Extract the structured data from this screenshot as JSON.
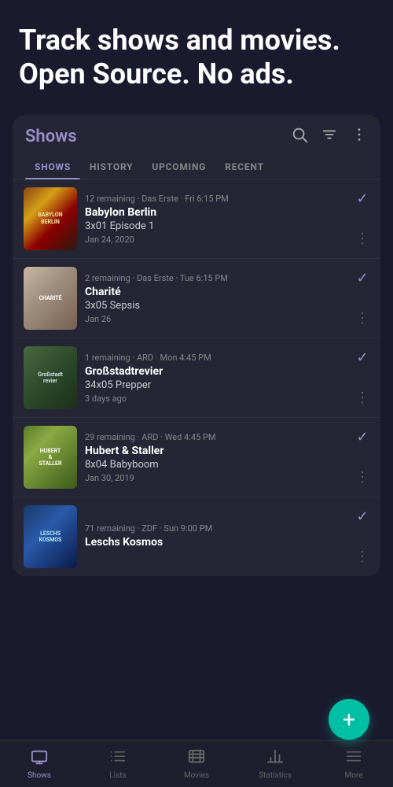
{
  "hero": {
    "title": "Track shows and movies. Open Source. No ads."
  },
  "card": {
    "title": "Shows",
    "tabs": [
      {
        "label": "SHOWS",
        "active": true
      },
      {
        "label": "HISTORY",
        "active": false
      },
      {
        "label": "UPCOMING",
        "active": false
      },
      {
        "label": "RECENT",
        "active": false
      }
    ]
  },
  "shows": [
    {
      "id": 1,
      "poster_label": "BABYLON\nBERLIN",
      "poster_class": "poster-babylon",
      "meta": "12 remaining · Das Erste · Fri 6:15 PM",
      "title": "Babylon Berlin",
      "episode": "3x01 Episode 1",
      "date": "Jan 24, 2020"
    },
    {
      "id": 2,
      "poster_label": "CHARITÉ",
      "poster_class": "poster-charite",
      "meta": "2 remaining · Das Erste · Tue 6:15 PM",
      "title": "Charité",
      "episode": "3x05 Sepsis",
      "date": "Jan 26"
    },
    {
      "id": 3,
      "poster_label": "Großstadt\nrevier",
      "poster_class": "poster-grossstadt",
      "meta": "1 remaining · ARD · Mon 4:45 PM",
      "title": "Großstadtrevier",
      "episode": "34x05 Prepper",
      "date": "3 days ago"
    },
    {
      "id": 4,
      "poster_label": "HUBERT\nUND\nSTALLER",
      "poster_class": "poster-hubert",
      "meta": "29 remaining · ARD · Wed 4:45 PM",
      "title": "Hubert & Staller",
      "episode": "8x04 Babyboom",
      "date": "Jan 30, 2019"
    },
    {
      "id": 5,
      "poster_label": "LESCHS\nKOSMOS",
      "poster_class": "poster-leschs",
      "meta": "71 remaining · ZDF · Sun 9:00 PM",
      "title": "Leschs Kosmos",
      "episode": "",
      "date": ""
    }
  ],
  "fab": {
    "label": "+"
  },
  "bottom_nav": [
    {
      "label": "Shows",
      "active": true,
      "icon": "tv"
    },
    {
      "label": "Lists",
      "active": false,
      "icon": "list"
    },
    {
      "label": "Movies",
      "active": false,
      "icon": "movie"
    },
    {
      "label": "Statistics",
      "active": false,
      "icon": "stats"
    },
    {
      "label": "More",
      "active": false,
      "icon": "more"
    }
  ]
}
